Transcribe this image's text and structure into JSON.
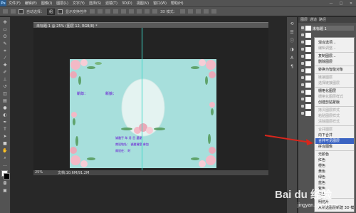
{
  "menubar": {
    "logo": "Ps",
    "items": [
      "文件(F)",
      "编辑(E)",
      "图像(I)",
      "图层(L)",
      "文字(Y)",
      "选择(S)",
      "滤镜(T)",
      "3D(D)",
      "视图(V)",
      "窗口(W)",
      "帮助(H)"
    ],
    "window_controls": [
      "—",
      "□",
      "✕"
    ]
  },
  "options_bar": {
    "auto_select_label": "自动选择：",
    "auto_select_value": "组",
    "show_transform_label": "显示变换控件",
    "mode_3d_label": "3D 模式："
  },
  "document": {
    "tab_title": "未标题-1 @ 25% (图层 12, RGB/8) *",
    "zoom": "25%",
    "doc_info": "文档:10.6M/91.2M"
  },
  "artboard": {
    "greeting_left": "新郎：",
    "greeting_right": "新娘：",
    "line1": "诚邀于    年    月    日    星期",
    "line2": "席设地址：    诚邀请您    参加",
    "line3": "席设在：                时"
  },
  "layers_panel": {
    "tabs": [
      "图层",
      "通道",
      "路径"
    ],
    "selected_layer": "未标题 1"
  },
  "context_menu": {
    "items": [
      {
        "label": "混合选项...",
        "state": "normal"
      },
      {
        "label": "编辑调整...",
        "state": "disabled"
      },
      {
        "label": "复制图层...",
        "state": "normal"
      },
      {
        "label": "删除图层",
        "state": "normal"
      },
      {
        "label": "转换为智能对象",
        "state": "normal"
      },
      {
        "label": "链接图层",
        "state": "disabled"
      },
      {
        "label": "选择链接图层",
        "state": "disabled"
      },
      {
        "label": "栅格化图层",
        "state": "normal"
      },
      {
        "label": "栅格化图层样式",
        "state": "disabled"
      },
      {
        "label": "创建剪贴蒙版",
        "state": "normal"
      },
      {
        "label": "拷贝图层样式",
        "state": "disabled"
      },
      {
        "label": "粘贴图层样式",
        "state": "disabled"
      },
      {
        "label": "清除图层样式",
        "state": "disabled"
      },
      {
        "label": "合并图层",
        "state": "disabled"
      },
      {
        "label": "向下合并",
        "state": "normal"
      },
      {
        "label": "合并可见图层",
        "state": "highlighted"
      },
      {
        "label": "拼合图像",
        "state": "normal"
      },
      {
        "label": "无颜色",
        "state": "normal"
      },
      {
        "label": "红色",
        "state": "normal"
      },
      {
        "label": "橙色",
        "state": "normal"
      },
      {
        "label": "黄色",
        "state": "normal"
      },
      {
        "label": "绿色",
        "state": "normal"
      },
      {
        "label": "蓝色",
        "state": "normal"
      },
      {
        "label": "紫色",
        "state": "normal"
      },
      {
        "label": "灰色",
        "state": "normal"
      },
      {
        "label": "明信片",
        "state": "normal"
      },
      {
        "label": "从所选图层新建 3D 模型",
        "state": "normal"
      }
    ]
  },
  "watermark": {
    "brand": "Bai du 经验",
    "url": "jingyan.baidu.com"
  },
  "colors": {
    "accent_highlight": "#3a63c2",
    "arrow": "#d9261c",
    "artboard_bg": "#a7dfdc",
    "invite_text": "#7b4fd6",
    "guide": "#3fd8c8"
  }
}
